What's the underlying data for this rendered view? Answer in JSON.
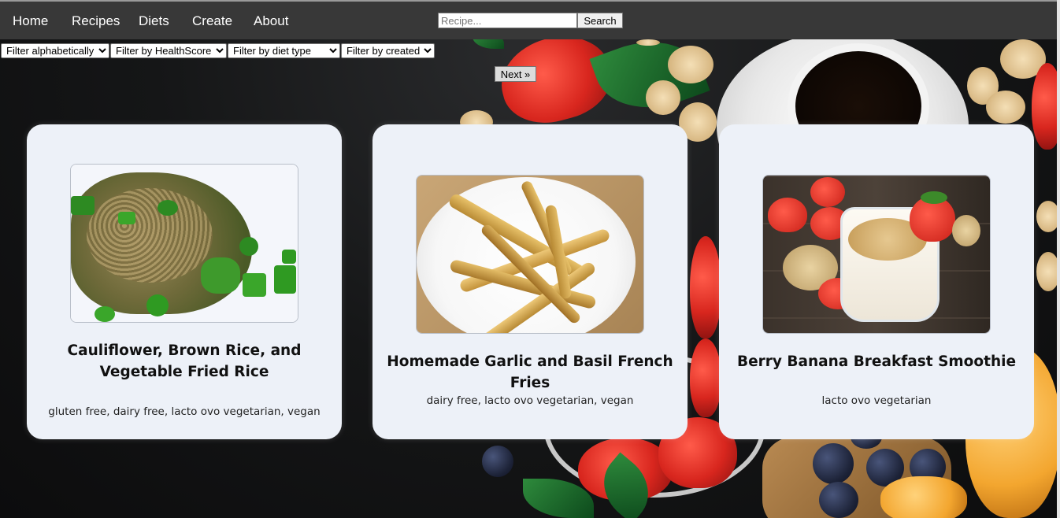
{
  "nav": {
    "links": [
      "Home",
      "Recipes",
      "Diets",
      "Create",
      "About"
    ],
    "search_placeholder": "Recipe...",
    "search_button": "Search"
  },
  "filters": {
    "alphabetical": "Filter alphabetically",
    "health_score": "Filter by HealthScore",
    "diet_type": "Filter by diet type",
    "created": "Filter by created"
  },
  "pagination": {
    "next_label": "Next »"
  },
  "recipes": [
    {
      "title": "Cauliflower, Brown Rice, and Vegetable Fried Rice",
      "diets": "gluten free, dairy free, lacto ovo vegetarian, vegan",
      "image_icon": "fried-rice-photo"
    },
    {
      "title": "Homemade Garlic and Basil French Fries",
      "diets": "dairy free, lacto ovo vegetarian, vegan",
      "image_icon": "french-fries-photo"
    },
    {
      "title": "Berry Banana Breakfast Smoothie",
      "diets": "lacto ovo vegetarian",
      "image_icon": "smoothie-photo"
    }
  ],
  "colors": {
    "navbar": "#383838",
    "card_bg": "#edf1f8",
    "page_bg": "#121314"
  }
}
